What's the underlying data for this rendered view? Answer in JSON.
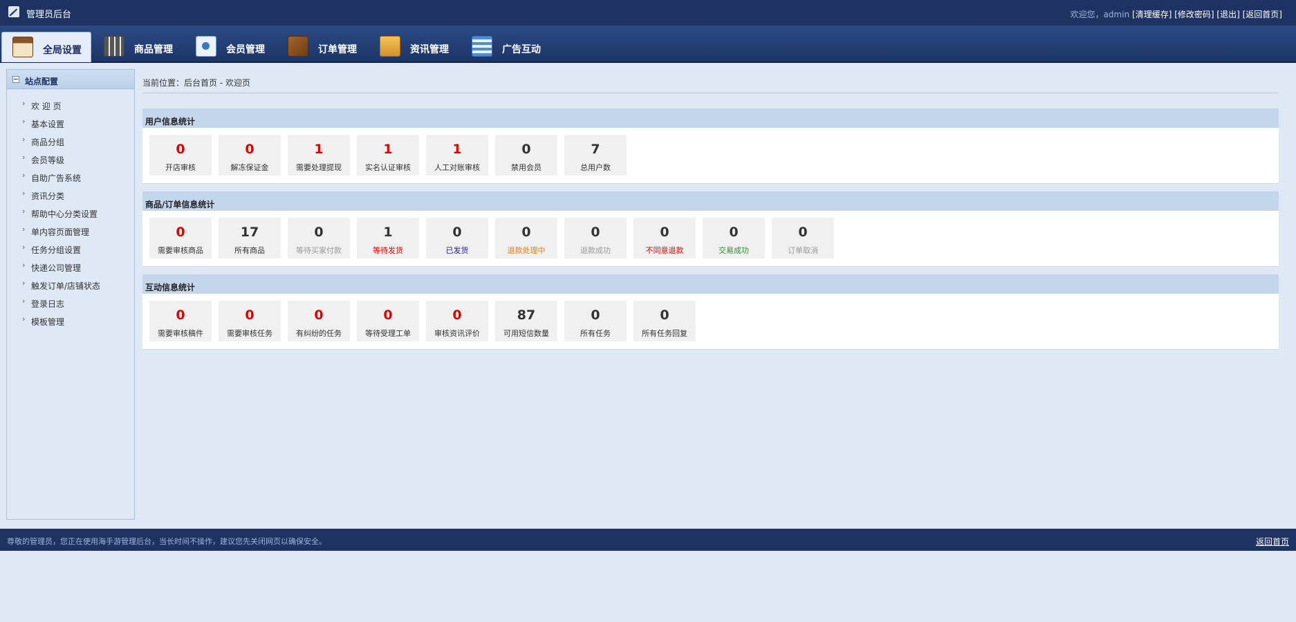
{
  "header": {
    "title": "管理员后台",
    "welcome": "欢迎您，admin",
    "links": [
      "[清理缓存]",
      "[修改密码]",
      "[退出]",
      "[返回首页]"
    ]
  },
  "nav_tabs": [
    {
      "label": "全局设置",
      "icon": "global-settings-icon",
      "active": true
    },
    {
      "label": "商品管理",
      "icon": "goods-icon",
      "active": false
    },
    {
      "label": "会员管理",
      "icon": "member-icon",
      "active": false
    },
    {
      "label": "订单管理",
      "icon": "order-icon",
      "active": false
    },
    {
      "label": "资讯管理",
      "icon": "news-icon",
      "active": false
    },
    {
      "label": "广告互动",
      "icon": "ad-icon",
      "active": false
    }
  ],
  "sidebar": {
    "title": "站点配置",
    "items": [
      "欢 迎 页",
      "基本设置",
      "商品分组",
      "会员等级",
      "自助广告系统",
      "资讯分类",
      "帮助中心分类设置",
      "单内容页面管理",
      "任务分组设置",
      "快递公司管理",
      "触发订单/店铺状态",
      "登录日志",
      "模板管理"
    ]
  },
  "breadcrumb": "当前位置：后台首页 - 欢迎页",
  "colors": {
    "red": "#e00000",
    "dark": "#333333",
    "gray": "#999999",
    "blue": "#1a1aa6",
    "orange": "#e87a1c",
    "green": "#2f8a2f",
    "header_bg": "#1f3363",
    "page_bg": "#dfe9f5"
  },
  "sections": [
    {
      "title": "用户信息统计",
      "cells": [
        {
          "value": "0",
          "label": "开店审核",
          "value_color": "red",
          "label_color": "dark"
        },
        {
          "value": "0",
          "label": "解冻保证金",
          "value_color": "red",
          "label_color": "dark"
        },
        {
          "value": "1",
          "label": "需要处理提现",
          "value_color": "red",
          "label_color": "dark"
        },
        {
          "value": "1",
          "label": "实名认证审核",
          "value_color": "red",
          "label_color": "dark"
        },
        {
          "value": "1",
          "label": "人工对账审核",
          "value_color": "red",
          "label_color": "dark"
        },
        {
          "value": "0",
          "label": "禁用会员",
          "value_color": "dark",
          "label_color": "dark"
        },
        {
          "value": "7",
          "label": "总用户数",
          "value_color": "dark",
          "label_color": "dark"
        }
      ]
    },
    {
      "title": "商品/订单信息统计",
      "cells": [
        {
          "value": "0",
          "label": "需要审核商品",
          "value_color": "red",
          "label_color": "dark"
        },
        {
          "value": "17",
          "label": "所有商品",
          "value_color": "dark",
          "label_color": "dark"
        },
        {
          "value": "0",
          "label": "等待买家付款",
          "value_color": "dark",
          "label_color": "gray"
        },
        {
          "value": "1",
          "label": "等待发货",
          "value_color": "dark",
          "label_color": "red"
        },
        {
          "value": "0",
          "label": "已发货",
          "value_color": "dark",
          "label_color": "blue"
        },
        {
          "value": "0",
          "label": "退款处理中",
          "value_color": "dark",
          "label_color": "orange"
        },
        {
          "value": "0",
          "label": "退款成功",
          "value_color": "dark",
          "label_color": "gray"
        },
        {
          "value": "0",
          "label": "不同意退款",
          "value_color": "dark",
          "label_color": "red"
        },
        {
          "value": "0",
          "label": "交易成功",
          "value_color": "dark",
          "label_color": "green"
        },
        {
          "value": "0",
          "label": "订单取消",
          "value_color": "dark",
          "label_color": "gray"
        }
      ]
    },
    {
      "title": "互动信息统计",
      "cells": [
        {
          "value": "0",
          "label": "需要审核稿件",
          "value_color": "red",
          "label_color": "dark"
        },
        {
          "value": "0",
          "label": "需要审核任务",
          "value_color": "red",
          "label_color": "dark"
        },
        {
          "value": "0",
          "label": "有纠纷的任务",
          "value_color": "red",
          "label_color": "dark"
        },
        {
          "value": "0",
          "label": "等待受理工单",
          "value_color": "red",
          "label_color": "dark"
        },
        {
          "value": "0",
          "label": "审核资讯评价",
          "value_color": "red",
          "label_color": "dark"
        },
        {
          "value": "87",
          "label": "可用短信数量",
          "value_color": "dark",
          "label_color": "dark"
        },
        {
          "value": "0",
          "label": "所有任务",
          "value_color": "dark",
          "label_color": "dark"
        },
        {
          "value": "0",
          "label": "所有任务回复",
          "value_color": "dark",
          "label_color": "dark"
        }
      ]
    }
  ],
  "footer": {
    "text": "尊敬的管理员，您正在使用海手游管理后台，当长时间不操作，建议您先关闭网页以确保安全。",
    "home_link": "返回首页"
  }
}
